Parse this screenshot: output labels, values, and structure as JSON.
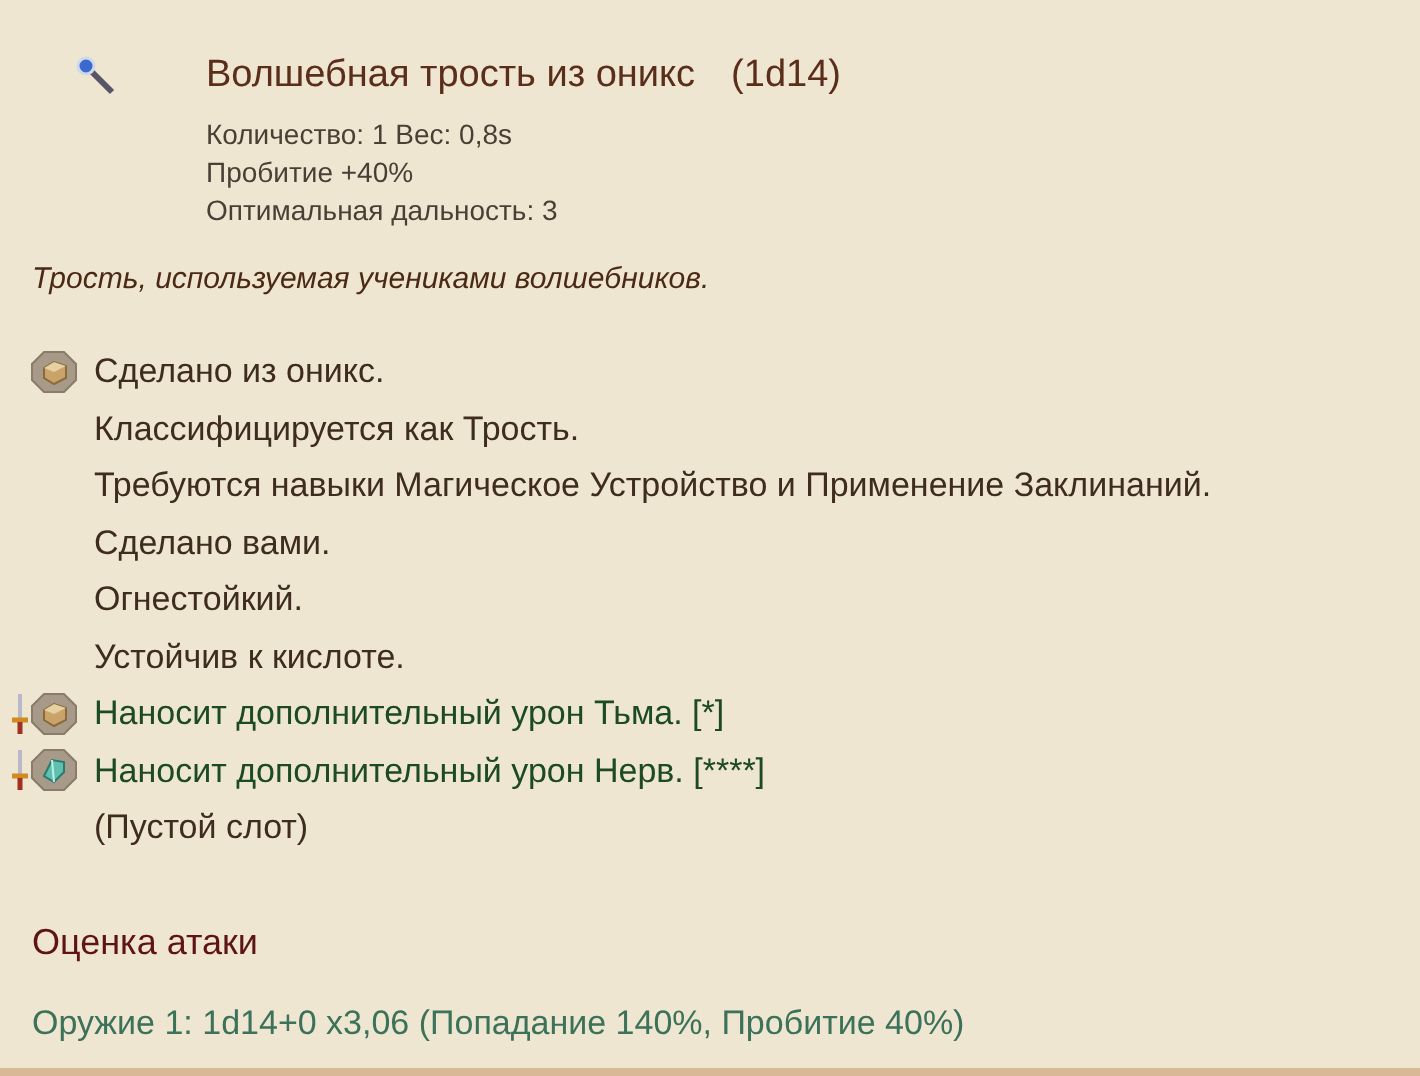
{
  "item": {
    "title": "Волшебная трость из оникс",
    "dice": "(1d14)",
    "stats": [
      "Количество: 1 Вес: 0,8s",
      "Пробитие +40%",
      "Оптимальная дальность: 3"
    ],
    "description": "Трость, используемая учениками волшебников."
  },
  "properties": [
    {
      "kind": "material",
      "text": "Сделано из оникс."
    },
    {
      "kind": "plain",
      "text": "Классифицируется как Трость."
    },
    {
      "kind": "plain",
      "text": "Требуются навыки Магическое Устройство и Применение Заклинаний."
    },
    {
      "kind": "plain",
      "text": "Сделано вами."
    },
    {
      "kind": "plain",
      "text": "Огнестойкий."
    },
    {
      "kind": "plain",
      "text": "Устойчив к кислоте."
    },
    {
      "kind": "enchant-box",
      "text": "Наносит дополнительный урон Тьма. [*]"
    },
    {
      "kind": "enchant-crystal",
      "text": "Наносит дополнительный урон Нерв. [****]"
    },
    {
      "kind": "slot",
      "text": "(Пустой слот)"
    }
  ],
  "attack": {
    "heading": "Оценка атаки",
    "lines": [
      "Оружие 1: 1d14+0 x3,06 (Попадание 140%, Пробитие 40%)"
    ]
  }
}
